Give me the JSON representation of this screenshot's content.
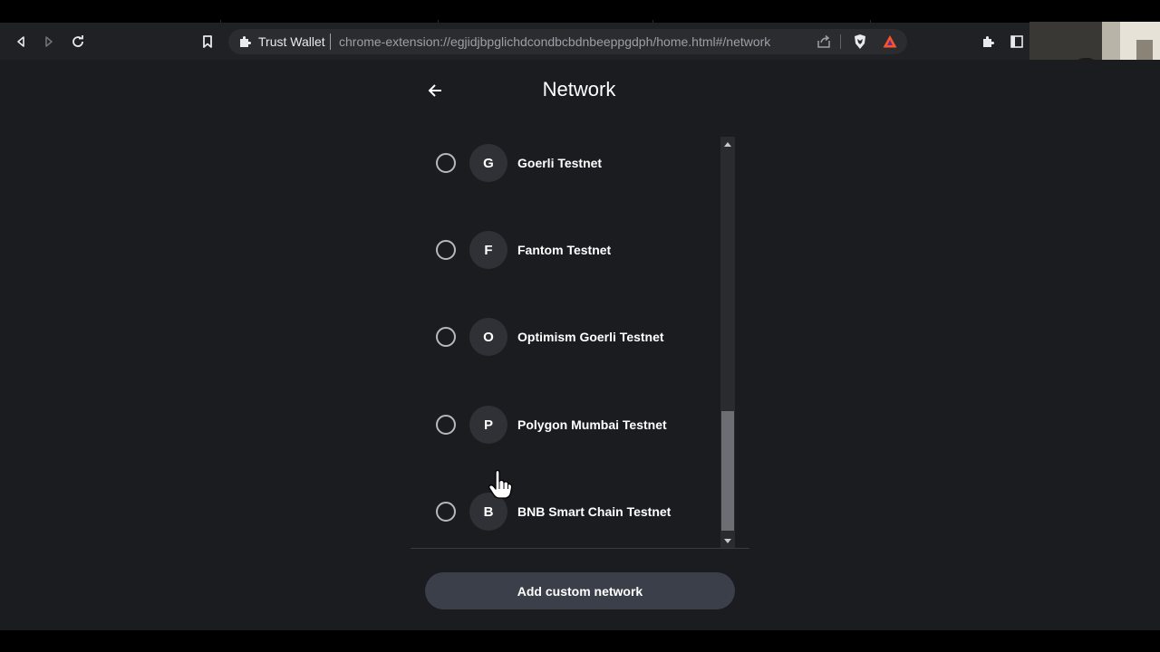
{
  "browser": {
    "site_name": "Trust Wallet",
    "url": "chrome-extension://egjidjbpglichdcondbcbdnbeeppgdph/home.html#/network",
    "icons": {
      "back": "back-arrow-icon",
      "forward": "forward-arrow-icon",
      "reload": "reload-icon",
      "bookmark": "bookmark-icon",
      "extension": "puzzle-icon",
      "share": "share-icon",
      "brave": "brave-shield-icon",
      "rewards": "bat-triangle-icon",
      "sidebar": "sidebar-icon"
    }
  },
  "header": {
    "title": "Network"
  },
  "networks": [
    {
      "letter": "G",
      "name": "Goerli Testnet"
    },
    {
      "letter": "F",
      "name": "Fantom Testnet"
    },
    {
      "letter": "O",
      "name": "Optimism Goerli Testnet"
    },
    {
      "letter": "P",
      "name": "Polygon Mumbai Testnet"
    },
    {
      "letter": "B",
      "name": "BNB Smart Chain Testnet"
    }
  ],
  "add_button": {
    "label": "Add custom network"
  },
  "colors": {
    "page_bg": "#1b1c20",
    "button_bg": "#3b3f49",
    "avatar_bg": "#2f3137",
    "brave_orange": "#fb542b"
  }
}
